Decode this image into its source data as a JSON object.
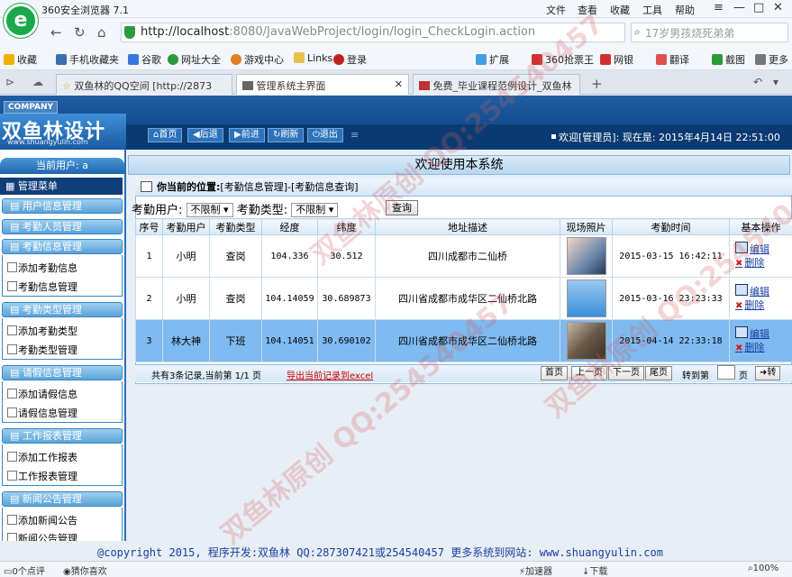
{
  "browser": {
    "title": "360安全浏览器 7.1",
    "menus": [
      "文件",
      "查看",
      "收藏",
      "工具",
      "帮助"
    ],
    "address_host": "http://localhost",
    "address_rest": ":8080/JavaWebProject/login/login_CheckLogin.action",
    "search_text": "17岁男孩烧死弟弟",
    "bookmarks": [
      "收藏",
      "手机收藏夹",
      "谷歌",
      "网址大全",
      "游戏中心",
      "Links",
      "登录",
      "扩展",
      "360抢票王",
      "网银",
      "翻译",
      "截图",
      "更多"
    ],
    "tabs": [
      "双鱼林的QQ空间 [http://2873",
      "管理系统主界面",
      "免费_毕业课程范例设计_双鱼林"
    ]
  },
  "header": {
    "company": "COMPANY",
    "logo_name": "双鱼林设计",
    "logo_url": "www.shuangyulin.com",
    "nav": [
      "首页",
      "后退",
      "前进",
      "刷新",
      "退出"
    ],
    "welcome": "欢迎[管理员]: 现在是: 2015年4月14日 22:51:00"
  },
  "sidebar": {
    "current_user": "当前用户: a",
    "menu_title": "管理菜单",
    "groups": [
      {
        "label": "用户信息管理",
        "items": []
      },
      {
        "label": "考勤人员管理",
        "items": []
      },
      {
        "label": "考勤信息管理",
        "items": [
          "添加考勤信息",
          "考勤信息管理"
        ]
      },
      {
        "label": "考勤类型管理",
        "items": [
          "添加考勤类型",
          "考勤类型管理"
        ]
      },
      {
        "label": "请假信息管理",
        "items": [
          "添加请假信息",
          "请假信息管理"
        ]
      },
      {
        "label": "工作报表管理",
        "items": [
          "添加工作报表",
          "工作报表管理"
        ]
      },
      {
        "label": "新闻公告管理",
        "items": [
          "添加新闻公告",
          "新闻公告管理"
        ]
      }
    ]
  },
  "main": {
    "welcome_title": "欢迎使用本系统",
    "breadcrumb_label": "你当前的位置:",
    "breadcrumb_path": "[考勤信息管理]-[考勤信息查询]",
    "filter": {
      "user_label": "考勤用户:",
      "user_value": "不限制",
      "type_label": "考勤类型:",
      "type_value": "不限制",
      "query_button": "查询"
    },
    "columns": [
      "序号",
      "考勤用户",
      "考勤类型",
      "经度",
      "纬度",
      "地址描述",
      "现场照片",
      "考勤时间",
      "基本操作"
    ],
    "rows": [
      {
        "no": "1",
        "user": "小明",
        "type": "查岗",
        "lng": "104.336",
        "lat": "30.512",
        "addr": "四川成都市二仙桥",
        "time": "2015-03-15 16:42:11"
      },
      {
        "no": "2",
        "user": "小明",
        "type": "查岗",
        "lng": "104.14059",
        "lat": "30.689873",
        "addr": "四川省成都市成华区二仙桥北路",
        "time": "2015-03-16 23:23:33"
      },
      {
        "no": "3",
        "user": "林大神",
        "type": "下班",
        "lng": "104.14051",
        "lat": "30.690102",
        "addr": "四川省成都市成华区二仙桥北路",
        "time": "2015-04-14 22:33:18"
      }
    ],
    "edit_label": "编辑",
    "delete_label": "删除",
    "pager": {
      "info": "共有3条记录,当前第 1/1 页",
      "export": "导出当前记录到excel",
      "buttons": [
        "首页",
        "上一页",
        "下一页",
        "尾页"
      ],
      "jump_label": "转到第",
      "page_unit": "页",
      "go": "转"
    }
  },
  "footer": "@copyright 2015, 程序开发:双鱼林 QQ:287307421或254540457 更多系统到网站: www.shuangyulin.com",
  "status": {
    "left1": "0个点评",
    "left2": "猜你喜欢",
    "r1": "加速器",
    "r2": "下载",
    "zoom": "100%"
  },
  "watermark": "双鱼林原创 QQ:254540457"
}
